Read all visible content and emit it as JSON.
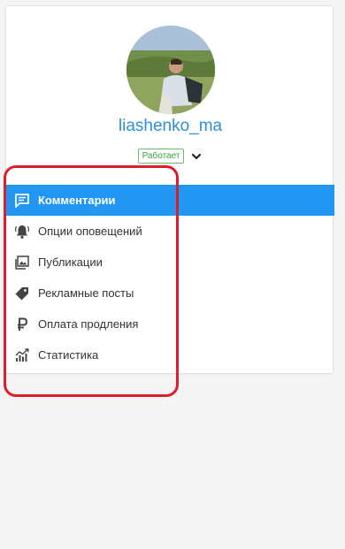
{
  "profile": {
    "username": "liashenko_ma",
    "status": "Работает",
    "status_color": "#3b9f40"
  },
  "menu": {
    "items": [
      {
        "label": "Комментарии",
        "icon": "comment-icon",
        "active": true
      },
      {
        "label": "Опции оповещений",
        "icon": "bell-icon",
        "active": false
      },
      {
        "label": "Публикации",
        "icon": "images-icon",
        "active": false
      },
      {
        "label": "Рекламные посты",
        "icon": "tag-icon",
        "active": false
      },
      {
        "label": "Оплата продления",
        "icon": "ruble-icon",
        "active": false
      },
      {
        "label": "Статистика",
        "icon": "chart-icon",
        "active": false
      }
    ]
  },
  "colors": {
    "accent": "#2196f3",
    "username": "#2e8fd6",
    "annotation": "#d8202b"
  }
}
